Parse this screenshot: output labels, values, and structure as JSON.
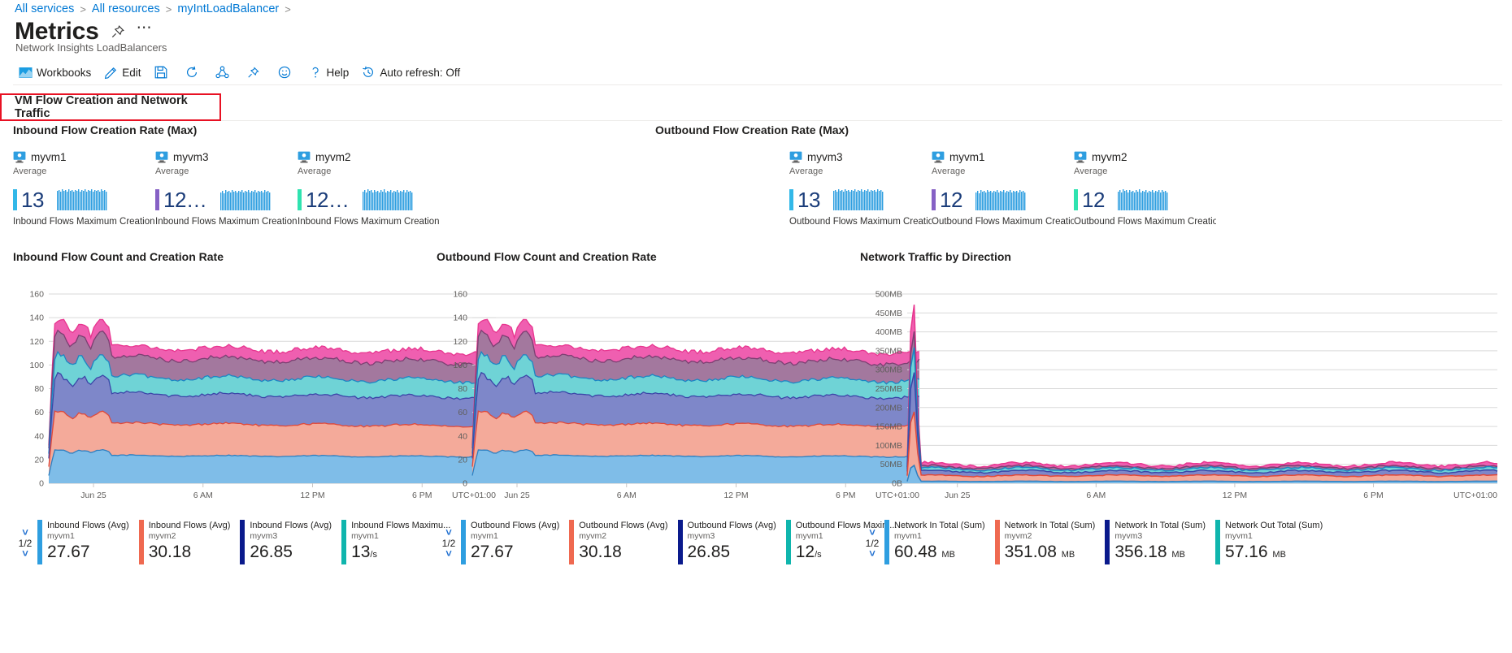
{
  "breadcrumb": {
    "items": [
      {
        "label": "All services"
      },
      {
        "label": "All resources"
      },
      {
        "label": "myIntLoadBalancer"
      }
    ],
    "separator": ">"
  },
  "header": {
    "title": "Metrics",
    "subtitle": "Network Insights LoadBalancers",
    "pin_icon": "pin-icon",
    "more_label": "⋯"
  },
  "toolbar": {
    "items": [
      {
        "label": "Workbooks",
        "icon": "workbooks-icon"
      },
      {
        "label": "Edit",
        "icon": "pencil-icon"
      },
      {
        "label": "",
        "icon": "save-icon"
      },
      {
        "label": "",
        "icon": "refresh-icon"
      },
      {
        "label": "",
        "icon": "share-icon"
      },
      {
        "label": "",
        "icon": "pin-icon"
      },
      {
        "label": "",
        "icon": "feedback-smiley-icon"
      },
      {
        "label": "Help",
        "icon": "question-icon"
      },
      {
        "label": "Auto refresh: Off",
        "icon": "clock-history-icon"
      }
    ]
  },
  "section": {
    "label": "VM Flow Creation and Network Traffic",
    "highlight_color": "#e81123"
  },
  "tile_panels": [
    {
      "title": "Inbound Flow Creation Rate (Max)",
      "tiles": [
        {
          "vm": "myvm1",
          "aggregation": "Average",
          "value": "13",
          "truncated": false,
          "caption": "Inbound Flows Maximum Creation R",
          "bar_color": "#32b8e8"
        },
        {
          "vm": "myvm3",
          "aggregation": "Average",
          "value": "12",
          "truncated": true,
          "caption": "Inbound Flows Maximum Creation R",
          "bar_color": "#8661c5"
        },
        {
          "vm": "myvm2",
          "aggregation": "Average",
          "value": "12",
          "truncated": true,
          "caption": "Inbound Flows Maximum Creation R",
          "bar_color": "#2fe3b0"
        }
      ]
    },
    {
      "title": "Outbound Flow Creation Rate (Max)",
      "tiles": [
        {
          "vm": "myvm3",
          "aggregation": "Average",
          "value": "13",
          "truncated": false,
          "caption": "Outbound Flows Maximum Creation",
          "bar_color": "#32b8e8"
        },
        {
          "vm": "myvm1",
          "aggregation": "Average",
          "value": "12",
          "truncated": false,
          "caption": "Outbound Flows Maximum Creation",
          "bar_color": "#8661c5"
        },
        {
          "vm": "myvm2",
          "aggregation": "Average",
          "value": "12",
          "truncated": false,
          "caption": "Outbound Flows Maximum Creation",
          "bar_color": "#2fe3b0"
        }
      ]
    }
  ],
  "chart_data": [
    {
      "type": "area",
      "title": "Inbound Flow Count and Creation Rate",
      "xlabel": "",
      "ylabel": "",
      "ylim": [
        0,
        160
      ],
      "yticks": [
        0,
        20,
        40,
        60,
        80,
        100,
        120,
        140,
        160
      ],
      "ytick_labels": [
        "0",
        "20",
        "40",
        "60",
        "80",
        "100",
        "120",
        "140",
        "160"
      ],
      "xtick_labels": [
        "Jun 25",
        "6 AM",
        "12 PM",
        "6 PM",
        "UTC+01:00"
      ],
      "grid": true,
      "legend_position": "bottom",
      "page": "1/2",
      "series": [
        {
          "name": "Inbound Flows (Avg)",
          "resource": "myvm1",
          "value": "27.67",
          "unit": "",
          "color": "#2e9ee0"
        },
        {
          "name": "Inbound Flows (Avg)",
          "resource": "myvm2",
          "value": "30.18",
          "unit": "",
          "color": "#ef6950"
        },
        {
          "name": "Inbound Flows (Avg)",
          "resource": "myvm3",
          "value": "26.85",
          "unit": "",
          "color": "#0a1a8c"
        },
        {
          "name": "Inbound Flows Maximu...",
          "resource": "myvm1",
          "value": "13",
          "unit": "/s",
          "color": "#0fb5ad"
        }
      ],
      "stack_levels": [
        26,
        56,
        84,
        100,
        118,
        128
      ]
    },
    {
      "type": "area",
      "title": "Outbound Flow Count and Creation Rate",
      "xlabel": "",
      "ylabel": "",
      "ylim": [
        0,
        160
      ],
      "yticks": [
        0,
        20,
        40,
        60,
        80,
        100,
        120,
        140,
        160
      ],
      "ytick_labels": [
        "0",
        "20",
        "40",
        "60",
        "80",
        "100",
        "120",
        "140",
        "160"
      ],
      "xtick_labels": [
        "Jun 25",
        "6 AM",
        "12 PM",
        "6 PM",
        "UTC+01:00"
      ],
      "grid": true,
      "legend_position": "bottom",
      "page": "1/2",
      "series": [
        {
          "name": "Outbound Flows (Avg)",
          "resource": "myvm1",
          "value": "27.67",
          "unit": "",
          "color": "#2e9ee0"
        },
        {
          "name": "Outbound Flows (Avg)",
          "resource": "myvm2",
          "value": "30.18",
          "unit": "",
          "color": "#ef6950"
        },
        {
          "name": "Outbound Flows (Avg)",
          "resource": "myvm3",
          "value": "26.85",
          "unit": "",
          "color": "#0a1a8c"
        },
        {
          "name": "Outbound Flows Maxim...",
          "resource": "myvm1",
          "value": "12",
          "unit": "/s",
          "color": "#0fb5ad"
        }
      ],
      "stack_levels": [
        26,
        56,
        84,
        100,
        118,
        128
      ]
    },
    {
      "type": "area",
      "title": "Network Traffic by Direction",
      "xlabel": "",
      "ylabel": "",
      "ylim": [
        0,
        500
      ],
      "yticks": [
        0,
        50,
        100,
        150,
        200,
        250,
        300,
        350,
        400,
        450,
        500
      ],
      "ytick_labels": [
        "0B",
        "50MB",
        "100MB",
        "150MB",
        "200MB",
        "250MB",
        "300MB",
        "350MB",
        "400MB",
        "450MB",
        "500MB"
      ],
      "xtick_labels": [
        "Jun 25",
        "6 AM",
        "12 PM",
        "6 PM",
        "UTC+01:00"
      ],
      "grid": true,
      "legend_position": "bottom",
      "page": "1/2",
      "series": [
        {
          "name": "Network In Total (Sum)",
          "resource": "myvm1",
          "value": "60.48",
          "unit": "MB",
          "color": "#2e9ee0"
        },
        {
          "name": "Network In Total (Sum)",
          "resource": "myvm2",
          "value": "351.08",
          "unit": "MB",
          "color": "#ef6950"
        },
        {
          "name": "Network In Total (Sum)",
          "resource": "myvm3",
          "value": "356.18",
          "unit": "MB",
          "color": "#0a1a8c"
        },
        {
          "name": "Network Out Total (Sum)",
          "resource": "myvm1",
          "value": "57.16",
          "unit": "MB",
          "color": "#0fb5ad"
        }
      ],
      "spike_peak": 440,
      "baseline": 3
    }
  ]
}
